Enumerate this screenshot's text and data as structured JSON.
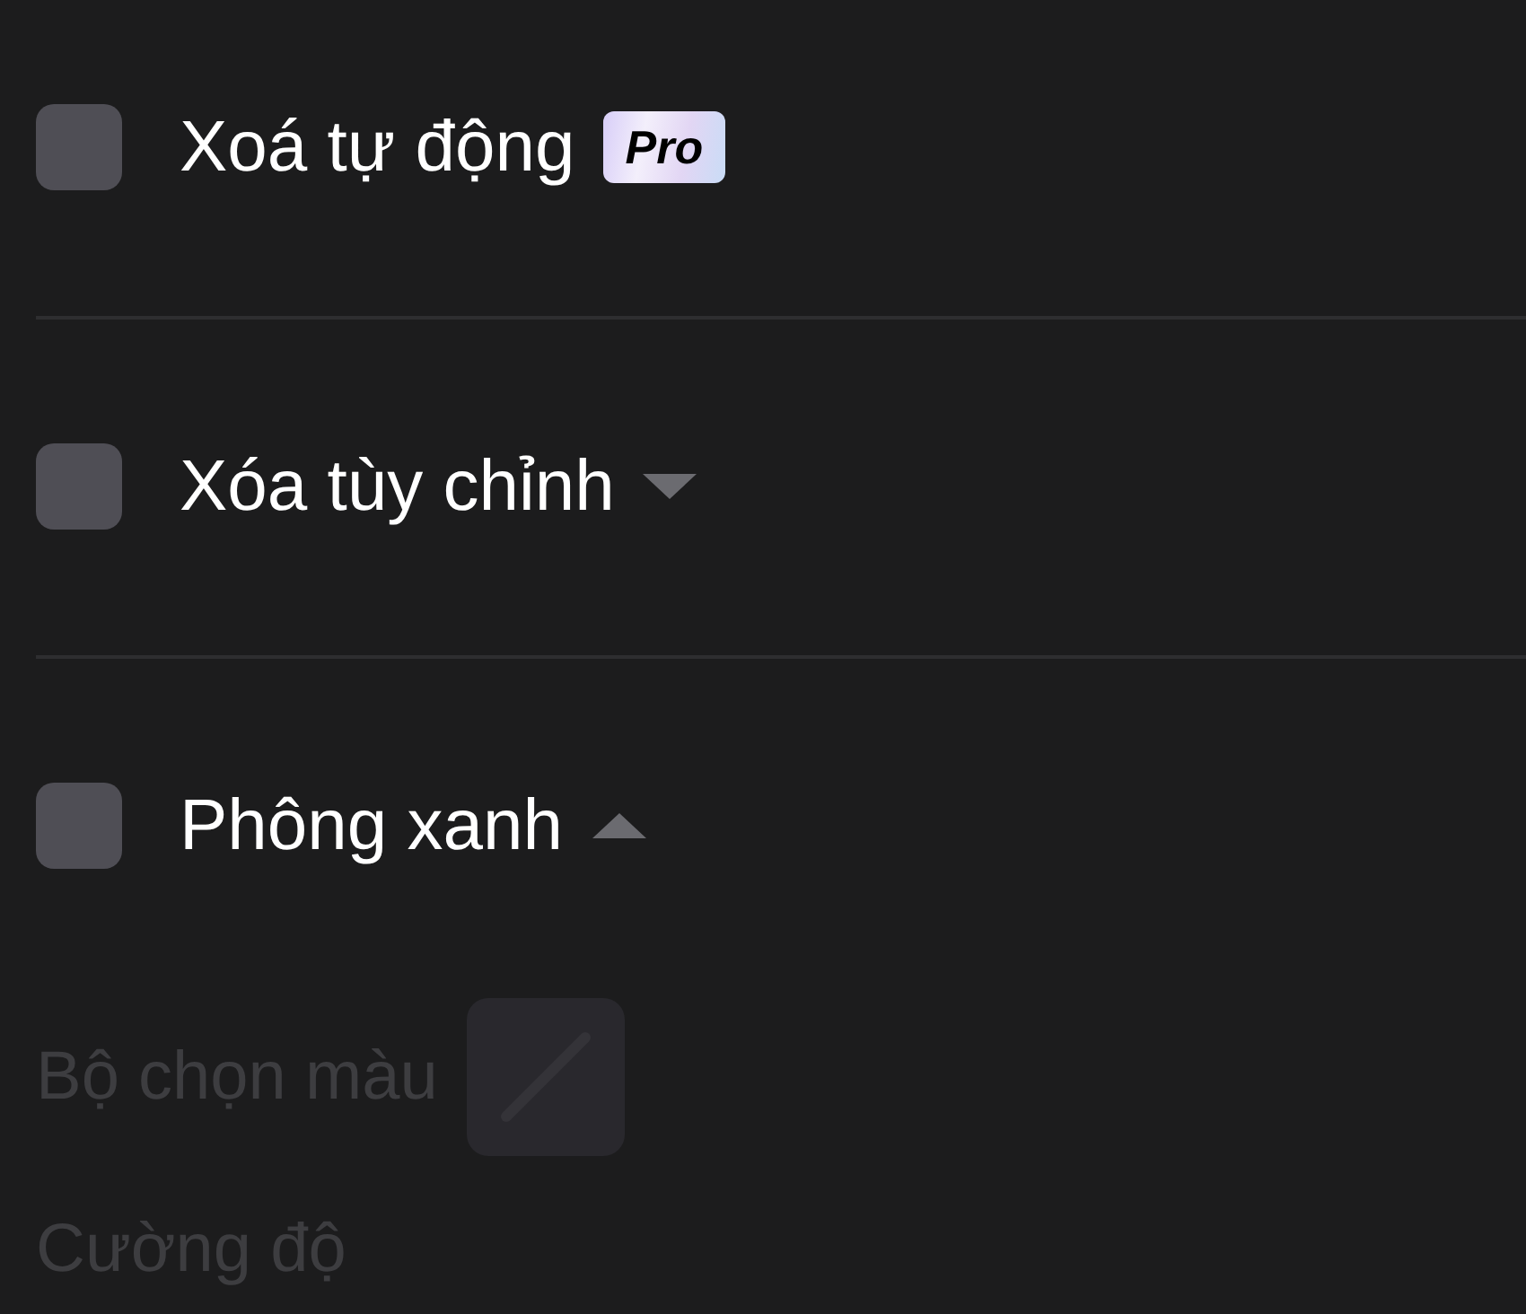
{
  "options": [
    {
      "label": "Xoá tự động",
      "checked": false,
      "badge": "Pro"
    },
    {
      "label": "Xóa tùy chỉnh",
      "checked": false,
      "expanded": false
    },
    {
      "label": "Phông xanh",
      "checked": false,
      "expanded": true
    }
  ],
  "chroma_settings": {
    "disabled": true,
    "color_picker_label": "Bộ chọn màu",
    "intensity_label": "Cường độ"
  }
}
